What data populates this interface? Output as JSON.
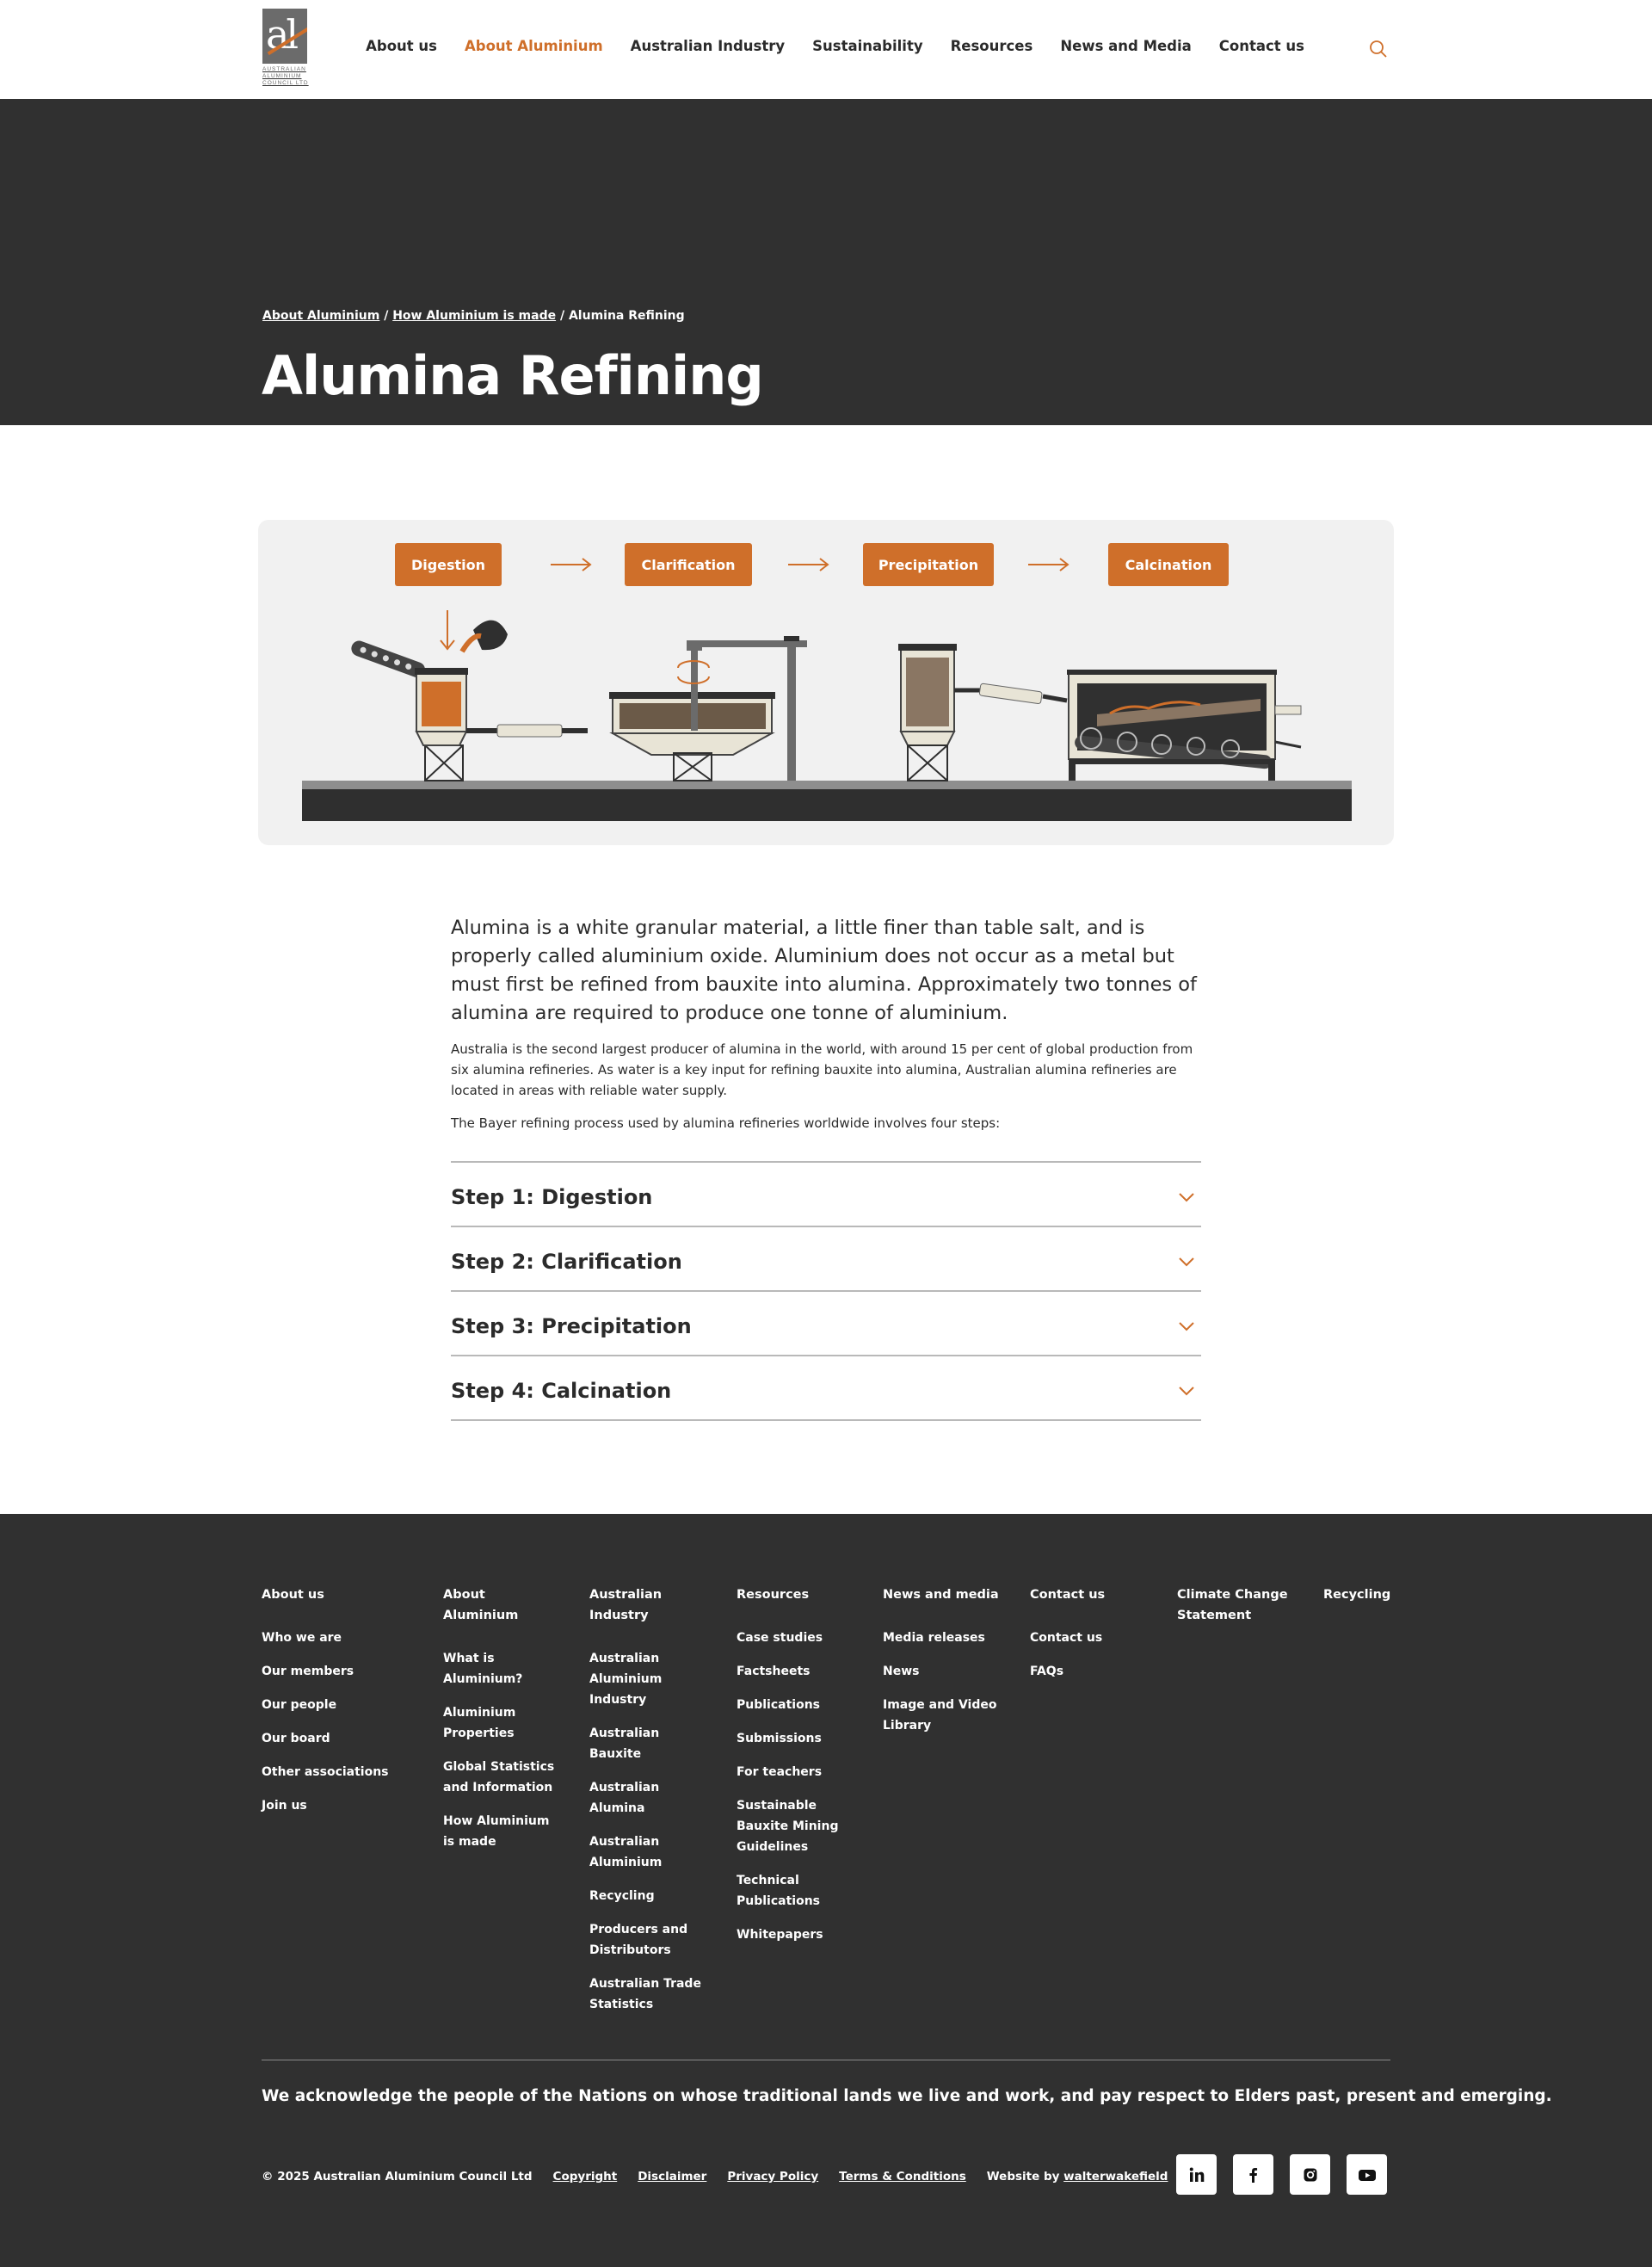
{
  "header": {
    "logo_alt_text": "AUSTRALIAN ALUMINIUM COUNCIL LTD",
    "logo_lines": [
      "AUSTRALIAN",
      "ALUMINIUM",
      "COUNCIL LTD"
    ],
    "nav": [
      {
        "label": "About us",
        "active": false
      },
      {
        "label": "About Aluminium",
        "active": true
      },
      {
        "label": "Australian Industry",
        "active": false
      },
      {
        "label": "Sustainability",
        "active": false
      },
      {
        "label": "Resources",
        "active": false
      },
      {
        "label": "News and Media",
        "active": false
      },
      {
        "label": "Contact us",
        "active": false
      }
    ],
    "search_icon": "search-icon"
  },
  "hero": {
    "breadcrumb": [
      {
        "label": "About Aluminium"
      },
      {
        "label": "How Aluminium is made"
      },
      {
        "label": "Alumina Refining"
      }
    ],
    "title": "Alumina Refining"
  },
  "diagram": {
    "stages": [
      "Digestion",
      "Clarification",
      "Precipitation",
      "Calcination"
    ]
  },
  "content": {
    "lead": "Alumina is a white granular material, a little finer than table salt, and is properly called aluminium oxide. Aluminium does not occur as a metal but must first be refined from bauxite into alumina. Approximately two tonnes of alumina are required to produce one tonne of aluminium.",
    "para1": "Australia is the second largest producer of alumina in the world, with around 15 per cent of global production from six alumina refineries. As water is a key input for refining bauxite into alumina, Australian alumina refineries are located in areas with reliable water supply.",
    "para2": "The Bayer refining process used by alumina refineries worldwide involves four steps:",
    "steps": [
      {
        "title": "Step 1: Digestion"
      },
      {
        "title": "Step 2: Clarification"
      },
      {
        "title": "Step 3: Precipitation"
      },
      {
        "title": "Step 4: Calcination"
      }
    ]
  },
  "footer": {
    "columns": [
      {
        "heading": "About us",
        "links": [
          "Who we are",
          "Our members",
          "Our people",
          "Our board",
          "Other associations",
          "Join us"
        ]
      },
      {
        "heading": "About Aluminium",
        "links": [
          "What is Aluminium?",
          "Aluminium Properties",
          "Global Statistics and Information",
          "How Aluminium is made"
        ]
      },
      {
        "heading": "Australian Industry",
        "links": [
          "Australian Aluminium Industry",
          "Australian Bauxite",
          "Australian Alumina",
          "Australian Aluminium",
          "Recycling",
          "Producers and Distributors",
          "Australian Trade Statistics"
        ]
      },
      {
        "heading": "Resources",
        "links": [
          "Case studies",
          "Factsheets",
          "Publications",
          "Submissions",
          "For teachers",
          "Sustainable Bauxite Mining Guidelines",
          "Technical Publications",
          "Whitepapers"
        ]
      },
      {
        "heading": "News and media",
        "links": [
          "Media releases",
          "News",
          "Image and Video Library"
        ]
      },
      {
        "heading": "Contact us",
        "links": [
          "Contact us",
          "FAQs"
        ]
      },
      {
        "heading": "Climate Change Statement",
        "links": []
      },
      {
        "heading": "Recycling",
        "links": []
      }
    ],
    "acknowledgement": "We acknowledge the people of the Nations on whose traditional lands we live and work, and pay respect to Elders past, present and emerging.",
    "copyright": "© 2025 Australian Aluminium Council Ltd",
    "legal_links": [
      "Copyright",
      "Disclaimer",
      "Privacy Policy",
      "Terms & Conditions"
    ],
    "credit_prefix": "Website by ",
    "credit_link": "walterwakefield",
    "socials": [
      "linkedin-icon",
      "facebook-icon",
      "instagram-icon",
      "youtube-icon"
    ]
  },
  "colors": {
    "accent": "#cf6f2a",
    "dark": "#303030",
    "text": "#2b2b2b"
  }
}
